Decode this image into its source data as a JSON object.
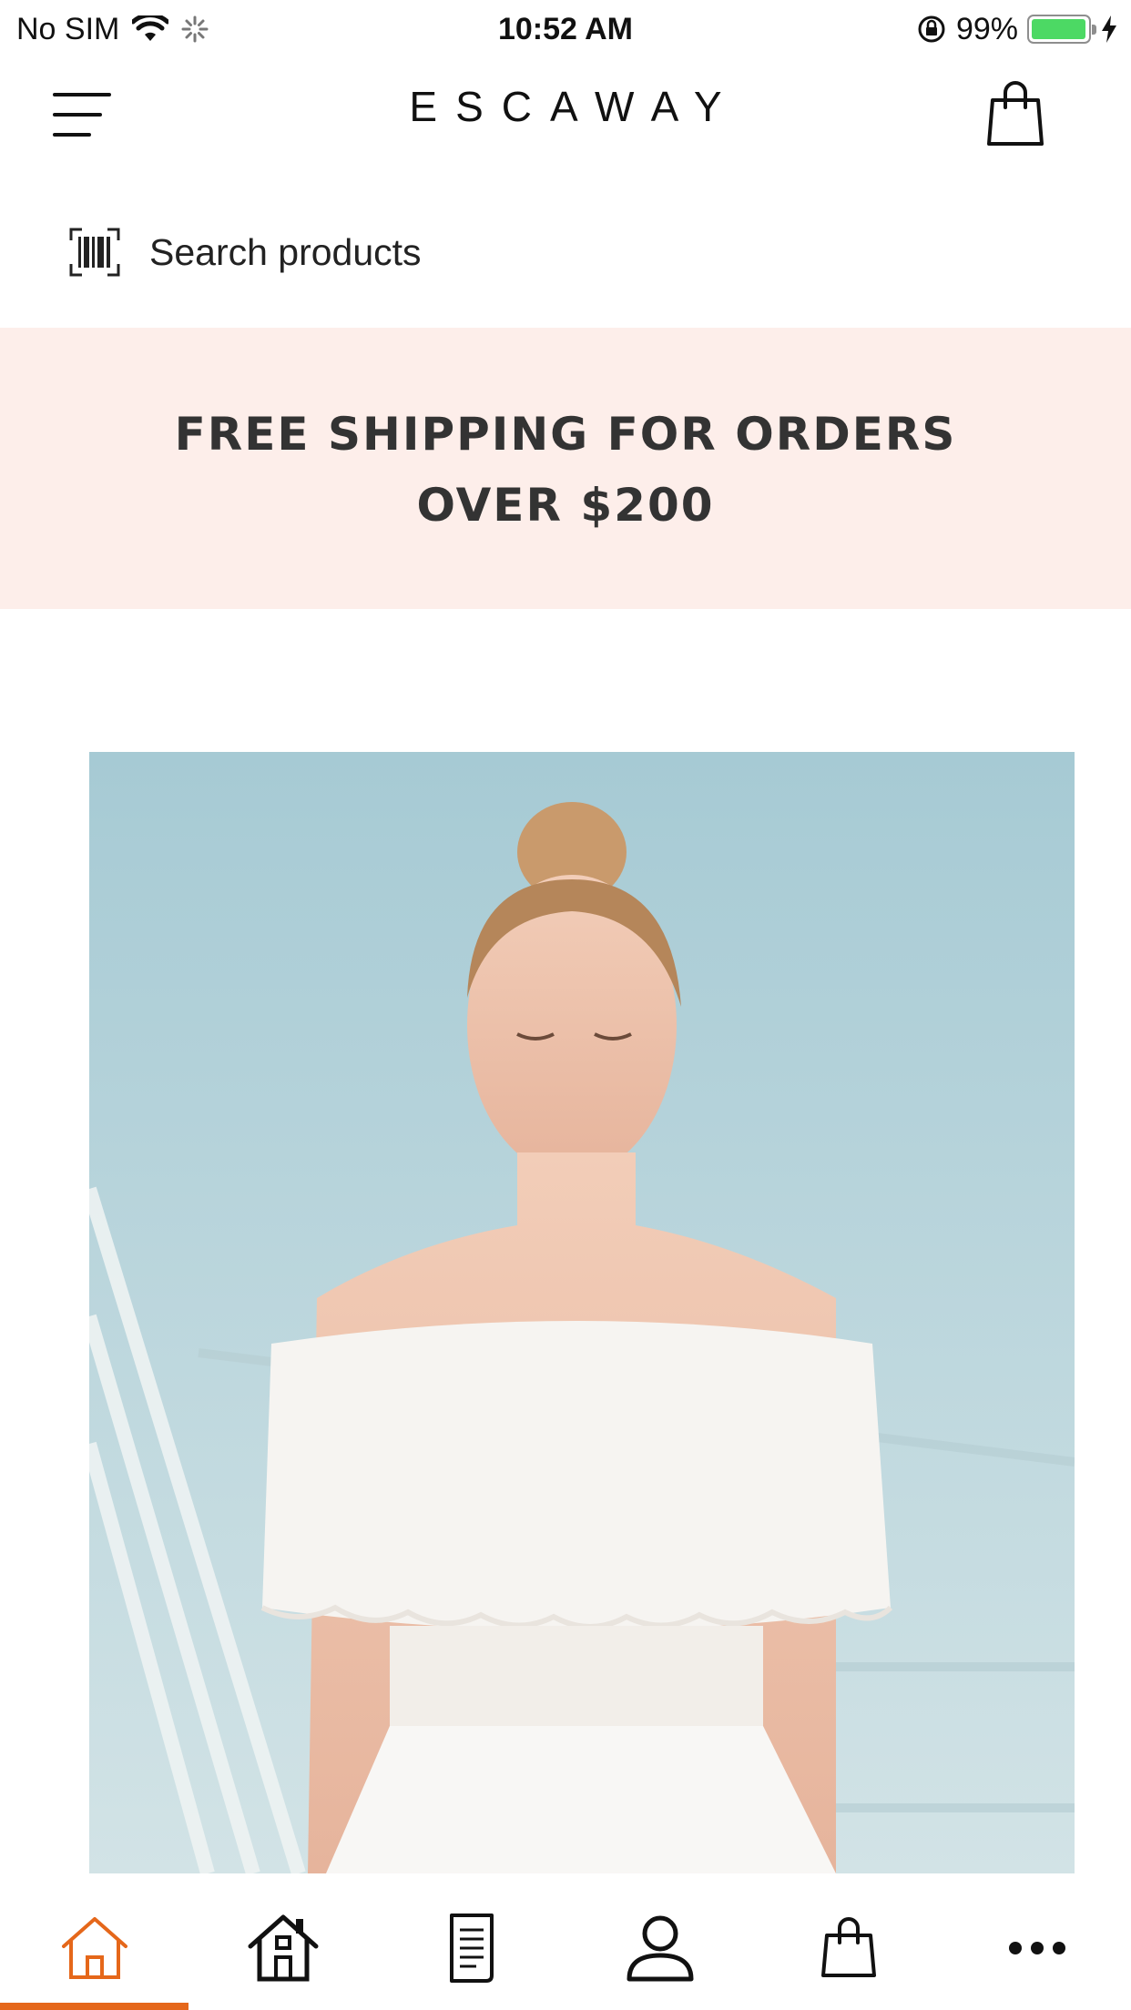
{
  "status_bar": {
    "carrier": "No SIM",
    "time": "10:52 AM",
    "battery": "99%",
    "battery_level": 0.99
  },
  "header": {
    "brand": "ESCAWAY",
    "menu_icon": "hamburger-menu-icon",
    "cart_icon": "shopping-bag-icon"
  },
  "search": {
    "placeholder": "Search products",
    "icon": "barcode-scan-icon"
  },
  "banner": {
    "line1": "FREE SHIPPING FOR ORDERS",
    "line2": "OVER $200",
    "background": "#fdeeea"
  },
  "tabbar": {
    "active_color": "#e5671a",
    "tabs": [
      {
        "icon": "home-icon",
        "active": true
      },
      {
        "icon": "store-icon",
        "active": false
      },
      {
        "icon": "document-icon",
        "active": false
      },
      {
        "icon": "profile-icon",
        "active": false
      },
      {
        "icon": "shopping-bag-icon",
        "active": false
      },
      {
        "icon": "more-icon",
        "active": false
      }
    ]
  }
}
